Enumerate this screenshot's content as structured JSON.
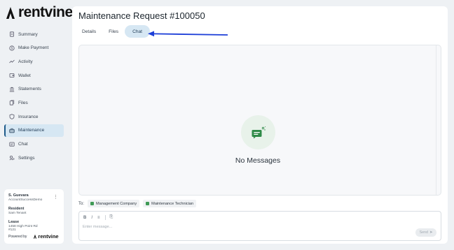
{
  "brand": {
    "name": "rentvine"
  },
  "sidebar": {
    "items": [
      {
        "label": "Summary",
        "icon": "document-icon",
        "active": false
      },
      {
        "label": "Make Payment",
        "icon": "dollar-icon",
        "active": false
      },
      {
        "label": "Activity",
        "icon": "activity-icon",
        "active": false
      },
      {
        "label": "Wallet",
        "icon": "wallet-icon",
        "active": false
      },
      {
        "label": "Statements",
        "icon": "bank-icon",
        "active": false
      },
      {
        "label": "Files",
        "icon": "files-icon",
        "active": false
      },
      {
        "label": "Insurance",
        "icon": "shield-icon",
        "active": false
      },
      {
        "label": "Maintenance",
        "icon": "toolbox-icon",
        "active": true
      },
      {
        "label": "Chat",
        "icon": "chat-icon",
        "active": false
      },
      {
        "label": "Settings",
        "icon": "settings-icon",
        "active": false
      }
    ]
  },
  "user_card": {
    "name": "S. Guevara",
    "account": "AccountSuccessDemo",
    "resident_label": "Resident",
    "resident_value": "Sam Tenant",
    "lease_label": "Lease",
    "lease_address_line1": "1458 High Point Rd",
    "lease_address_line2": "#121",
    "powered_by": "Powered by",
    "powered_brand": "rentvine"
  },
  "main": {
    "title": "Maintenance Request #100050",
    "tabs": [
      {
        "label": "Details",
        "active": false
      },
      {
        "label": "Files",
        "active": false
      },
      {
        "label": "Chat",
        "active": true
      }
    ],
    "chat": {
      "empty_text": "No Messages"
    },
    "to_label": "To:",
    "recipients": [
      "Management Company",
      "Maintenance Technician"
    ],
    "composer": {
      "toolbar": [
        "B",
        "I",
        "≡",
        "⎘"
      ],
      "placeholder": "Enter message...",
      "send_label": "Send"
    }
  },
  "colors": {
    "accent": "#1e5a8a",
    "active_bg": "#d6e7f3",
    "annotation_arrow": "#1d3fd8",
    "success_green": "#3f9a56"
  }
}
